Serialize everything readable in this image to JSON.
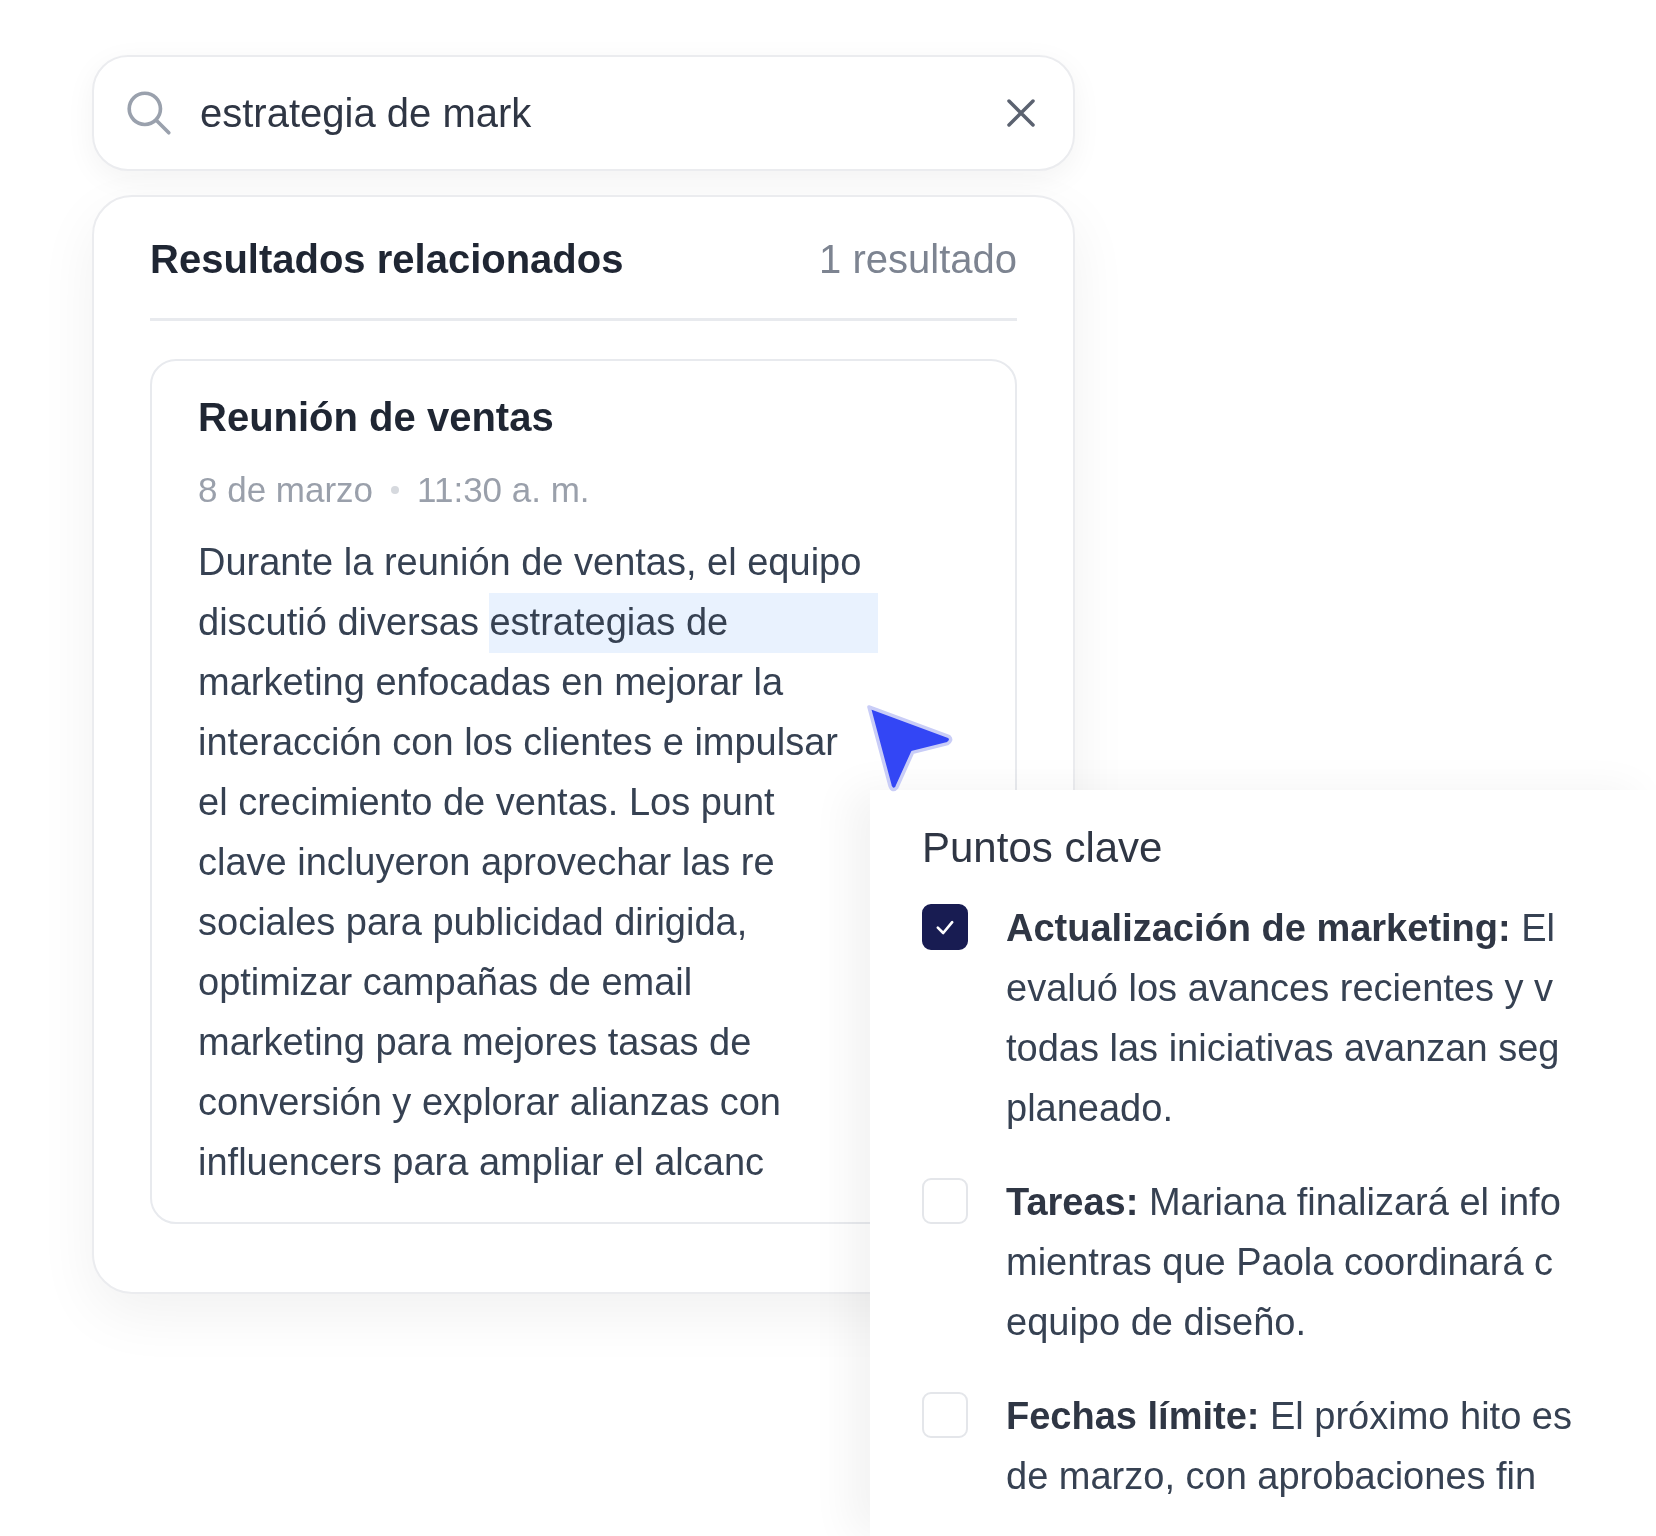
{
  "search": {
    "value": "estrategia de mark"
  },
  "results": {
    "title": "Resultados relacionados",
    "count": "1 resultado",
    "items": [
      {
        "title": "Reunión de ventas",
        "date": "8 de marzo",
        "time": "11:30 a. m.",
        "lines": [
          [
            {
              "text": "Durante la reunión de ventas, el equipo",
              "highlighted": false
            }
          ],
          [
            {
              "text": "discutió diversas ",
              "highlighted": false
            },
            {
              "text": "estrategias de",
              "highlighted": true
            }
          ],
          [
            {
              "text": "marketing enfocadas en mejorar la",
              "highlighted": false
            }
          ],
          [
            {
              "text": "interacción con los clientes e impulsar",
              "highlighted": false
            }
          ],
          [
            {
              "text": "el crecimiento de ventas. Los punt",
              "highlighted": false
            }
          ],
          [
            {
              "text": "clave incluyeron aprovechar las re",
              "highlighted": false
            }
          ],
          [
            {
              "text": "sociales para publicidad dirigida,",
              "highlighted": false
            }
          ],
          [
            {
              "text": "optimizar campañas de email",
              "highlighted": false
            }
          ],
          [
            {
              "text": "marketing para mejores tasas de",
              "highlighted": false
            }
          ],
          [
            {
              "text": "conversión y explorar alianzas con",
              "highlighted": false
            }
          ],
          [
            {
              "text": "influencers para ampliar el alcanc",
              "highlighted": false
            }
          ]
        ]
      }
    ]
  },
  "key_points": {
    "title": "Puntos clave",
    "items": [
      {
        "checked": true,
        "lines": [
          "**Actualización de marketing:** El",
          "evaluó los avances recientes y v",
          "todas las iniciativas avanzan seg",
          "planeado."
        ]
      },
      {
        "checked": false,
        "lines": [
          "**Tareas:** Mariana finalizará el info",
          "mientras que Paola coordinará c",
          "equipo de diseño."
        ]
      },
      {
        "checked": false,
        "lines": [
          "**Fechas límite:** El próximo hito es",
          "de marzo, con aprobaciones fin"
        ]
      }
    ]
  }
}
